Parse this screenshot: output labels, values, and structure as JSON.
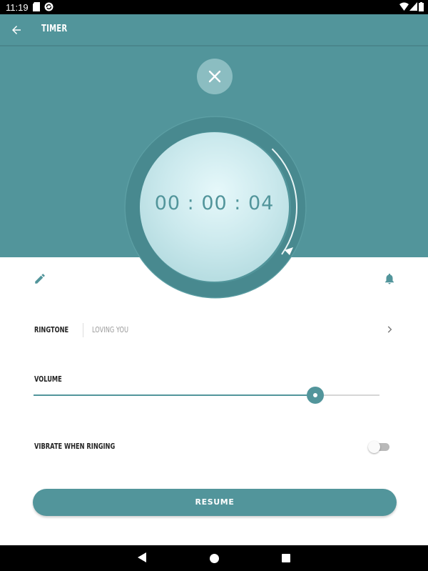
{
  "status_bar": {
    "time": "11:19",
    "left_icons": [
      "sd-card-icon",
      "sync-icon"
    ],
    "right_icons": [
      "wifi-icon",
      "signal-icon",
      "battery-icon"
    ]
  },
  "app_bar": {
    "title": "TIMER",
    "back_icon": "arrow-left-icon"
  },
  "timer": {
    "display": "00 : 00 : 04",
    "progress_fraction": 0.82,
    "close_icon": "close-icon"
  },
  "icons": {
    "edit": "pencil-icon",
    "alarm": "bell-icon"
  },
  "settings": {
    "ringtone_label": "RINGTONE",
    "ringtone_value": "LOVING YOU",
    "volume_label": "VOLUME",
    "volume_level": 0.81,
    "vibrate_label": "VIBRATE WHEN RINGING",
    "vibrate_on": false
  },
  "actions": {
    "resume_label": "RESUME"
  },
  "colors": {
    "accent": "#52959b",
    "accent_dark": "#4a868c",
    "dial_light": "#e6f8fa"
  },
  "nav_bar": {
    "icons": [
      "nav-back-icon",
      "nav-home-icon",
      "nav-recents-icon"
    ]
  }
}
